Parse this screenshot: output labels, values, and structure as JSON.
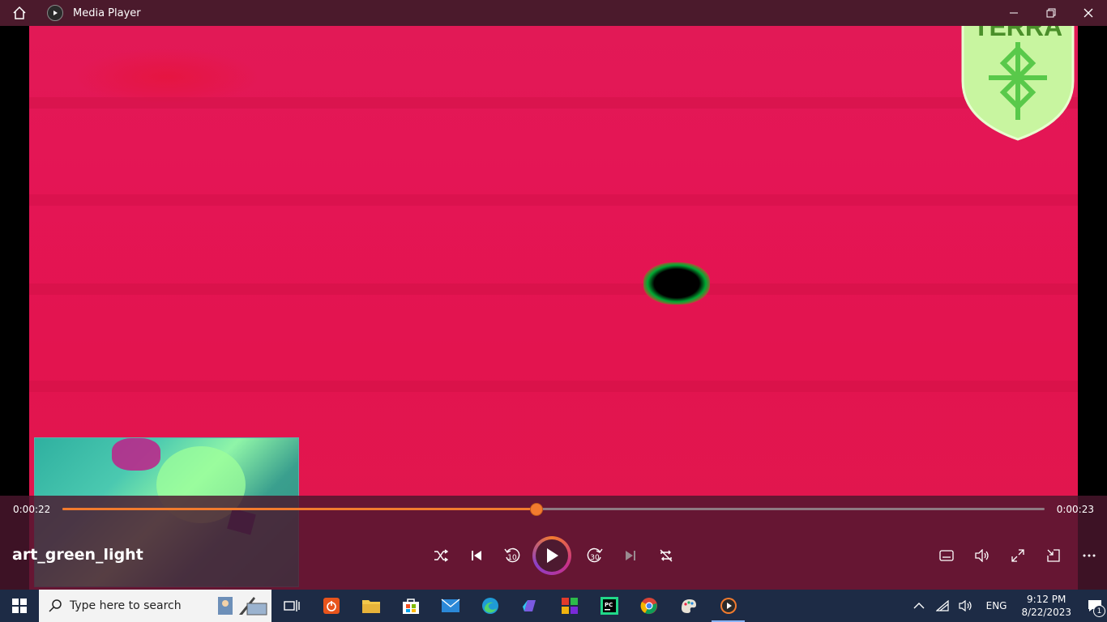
{
  "titlebar": {
    "title": "Media Player"
  },
  "logo": {
    "text": "TERRA"
  },
  "player": {
    "current_time": "0:00:22",
    "total_time": "0:00:23",
    "progress_fraction": 0.482,
    "track_name": "art_green_light",
    "skip_back_label": "10",
    "skip_forward_label": "30",
    "accent_color": "#f27b2e"
  },
  "taskbar": {
    "search_placeholder": "Type here to search",
    "language": "ENG",
    "time": "9:12 PM",
    "date": "8/22/2023",
    "notification_count": "1",
    "icons": [
      "task-view",
      "power-app",
      "file-explorer",
      "microsoft-store",
      "mail",
      "edge",
      "copilot",
      "office",
      "pycharm",
      "chrome",
      "paint",
      "media-player"
    ]
  }
}
